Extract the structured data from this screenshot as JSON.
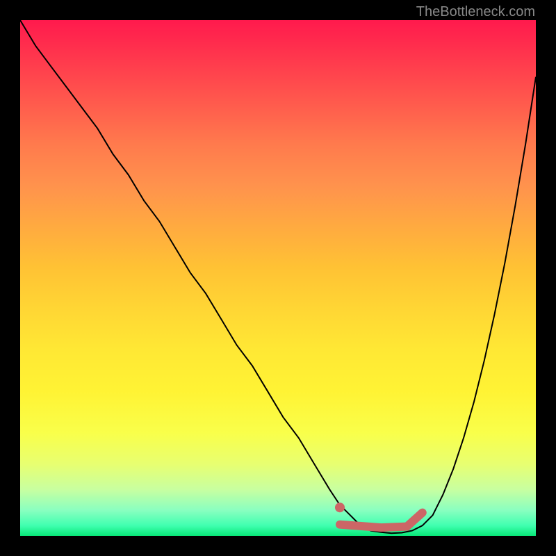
{
  "attribution": "TheBottleneck.com",
  "chart_data": {
    "type": "line",
    "title": "",
    "xlabel": "",
    "ylabel": "",
    "xlim": [
      0,
      100
    ],
    "ylim": [
      0,
      100
    ],
    "colors": {
      "curve": "#000000",
      "marker": "#cc6666",
      "gradient_top": "#ff1a4d",
      "gradient_bottom": "#08e878"
    },
    "series": [
      {
        "name": "bottleneck-curve",
        "x": [
          0,
          3,
          6,
          9,
          12,
          15,
          18,
          21,
          24,
          27,
          30,
          33,
          36,
          39,
          42,
          45,
          48,
          51,
          54,
          57,
          60,
          62,
          64,
          66,
          68,
          70,
          72,
          74,
          76,
          78,
          80,
          82,
          84,
          86,
          88,
          90,
          92,
          94,
          96,
          98,
          100
        ],
        "y": [
          100,
          95,
          91,
          87,
          83,
          79,
          74,
          70,
          65,
          61,
          56,
          51,
          47,
          42,
          37,
          33,
          28,
          23,
          19,
          14,
          9,
          6,
          4,
          2,
          1,
          0.7,
          0.5,
          0.6,
          1,
          2,
          4,
          8,
          13,
          19,
          26,
          34,
          43,
          53,
          64,
          76,
          89
        ]
      }
    ],
    "annotations": {
      "optimal_marker": {
        "dot_x": 62,
        "dot_y": 5.5,
        "segment": [
          {
            "x": 62,
            "y": 2.2
          },
          {
            "x": 70,
            "y": 1.6
          },
          {
            "x": 75,
            "y": 1.8
          },
          {
            "x": 78,
            "y": 4.5
          }
        ]
      }
    }
  }
}
